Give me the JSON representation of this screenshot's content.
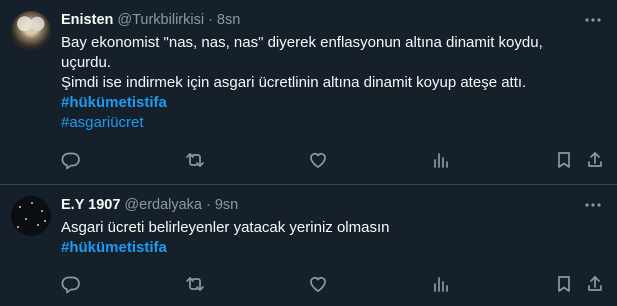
{
  "tweets": [
    {
      "author": {
        "name": "Enisten",
        "handle": "@Turkbilirkisi",
        "separator": "·",
        "time": "8sn"
      },
      "text_lines": [
        "Bay ekonomist \"nas, nas, nas\"  diyerek enflasyonun altına dinamit koydu,",
        "uçurdu.",
        "Şimdi ise indirmek için asgari ücretlinin altına dinamit koyup ateşe attı."
      ],
      "hashtags": [
        "#hükümetistifa",
        "#asgariücret"
      ]
    },
    {
      "author": {
        "name": "E.Y 1907",
        "handle": "@erdalyaka",
        "separator": "·",
        "time": "9sn"
      },
      "text_lines": [
        "Asgari ücreti belirleyenler yatacak yeriniz olmasın"
      ],
      "hashtags": [
        "#hükümetistifa"
      ]
    }
  ],
  "actions": [
    "reply-icon",
    "retweet-icon",
    "like-icon",
    "views-icon",
    "bookmark-icon",
    "share-icon"
  ],
  "colors": {
    "background": "#15202b",
    "text": "#f7f9f9",
    "muted": "#8b98a5",
    "link": "#1d9bf0",
    "divider": "#38444d"
  }
}
